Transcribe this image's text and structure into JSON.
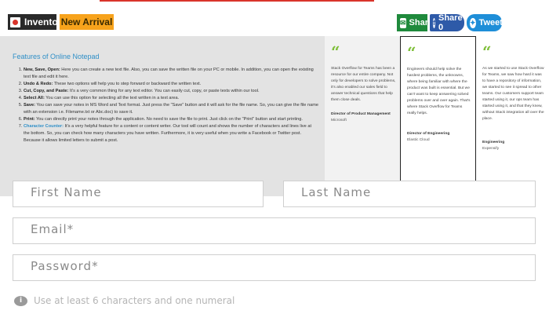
{
  "tags": {
    "inventory": "Inventory",
    "new_arrival": "New Arrival"
  },
  "share": {
    "share_label": "Share",
    "facebook_label": "Share 0",
    "tweet_label": "Tweet",
    "share_icon": "envelope-icon",
    "facebook_icon": "facebook-icon",
    "twitter_icon": "twitter-icon"
  },
  "features": {
    "title": "Features of Online Notepad",
    "items": [
      {
        "name": "New, Save, Open:",
        "text": " Here you can create a new text file. Also, you can save the written file on your PC or mobile. In addition, you can open the existing text file and edit it here."
      },
      {
        "name": "Undo & Redo:",
        "text": " These two options will help you to step forward or backward the written text."
      },
      {
        "name": "Cut, Copy, and Paste:",
        "text": " It's a very common thing for any text editor. You can easily cut, copy, or paste texts within our tool."
      },
      {
        "name": "Select All:",
        "text": " You can use this option for selecting all the text written in a text area."
      },
      {
        "name": "Save:",
        "text": " You can save your notes in MS Word and Text format. Just press the \"Save\" button and it will ask for the file name. So, you can give the file name with an extension i.e. Filename.txt or Abc.doc) to save it."
      },
      {
        "name": "Print:",
        "text": " You can directly print your notes through the application. No need to save the file to print. Just click on the \"Print\" button and start printing."
      },
      {
        "name": "Character Counter:",
        "text": " It's a very helpful feature for a content or content writer. Our tool will count and shows the number of characters and lines live at the bottom. So, you can check how many characters you have written. Furthermore, it is very useful when you write a Facebook or Twitter post. Because it allows limited letters to submit a post."
      }
    ]
  },
  "testimonials": [
    {
      "quote": "Stack Overflow for Teams has been a resource for our entire company. Not only for developers to solve problems, it's also enabled our sales field to answer technical questions that help them close deals.",
      "role": "Director of Product Management",
      "company": "Microsoft"
    },
    {
      "quote": "Engineers should help solve the hardest problems, the unknowns, where being familiar with where the product was built is essential. But we can't want to keep answering solved problems over and over again. That's where Stack Overflow for Teams really helps.",
      "role": "Director of Engineering",
      "company": "Elastic Cloud"
    },
    {
      "quote": "As we started to use Stack Overflow for Teams, we saw how hard it was to have a repository of information, we started to see it spread to other teams. Our customers support team started using it, our ops team has started using it, and that they knew, without Stack integration all over the place.",
      "role": "Engineering",
      "company": "Expensify"
    }
  ],
  "form": {
    "first_name_placeholder": "First Name",
    "last_name_placeholder": "Last Name",
    "email_placeholder": "Email*",
    "password_placeholder": "Password*",
    "password_hint": "Use at least 6 characters and one numeral"
  },
  "colors": {
    "accent_blue": "#2f8fc7",
    "quote_green": "#7fbf3a",
    "new_arrival": "#f7a31c"
  }
}
